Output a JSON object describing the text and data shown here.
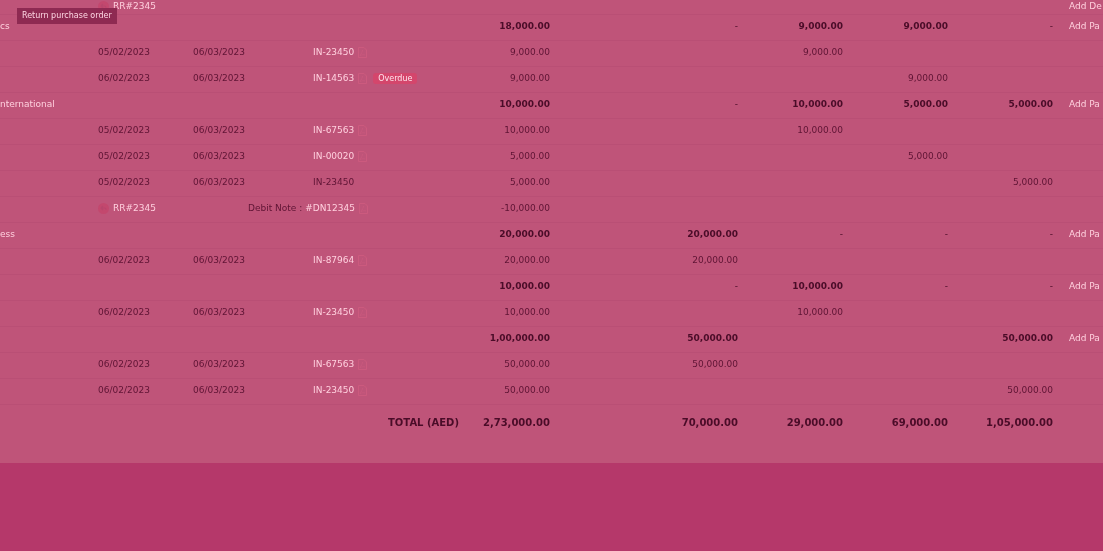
{
  "tooltip": "Return purchase order",
  "rows": [
    {
      "kind": "return",
      "reference": "RR#2345",
      "action": "Add De"
    },
    {
      "kind": "group",
      "name": "cs",
      "amount": "18,000.00",
      "buckets": {
        "bucket_1": "-",
        "bucket_2": "9,000.00",
        "bucket_3": "9,000.00",
        "bucket_4": "-"
      },
      "action": "Add Pa"
    },
    {
      "kind": "invoice",
      "invoice_date": "05/02/2023",
      "due_date": "06/03/2023",
      "invoice": "IN-23450",
      "linked": true,
      "pdf": true,
      "amount": "9,000.00",
      "buckets": {
        "bucket_2": "9,000.00"
      }
    },
    {
      "kind": "invoice",
      "invoice_date": "06/02/2023",
      "due_date": "06/03/2023",
      "invoice": "IN-14563",
      "linked": true,
      "pdf": true,
      "badge": "Overdue",
      "amount": "9,000.00",
      "buckets": {
        "bucket_3": "9,000.00"
      }
    },
    {
      "kind": "group",
      "name": "nternational",
      "amount": "10,000.00",
      "buckets": {
        "bucket_1": "-",
        "bucket_2": "10,000.00",
        "bucket_3": "5,000.00",
        "bucket_4": "5,000.00"
      },
      "action": "Add Pa"
    },
    {
      "kind": "invoice",
      "invoice_date": "05/02/2023",
      "due_date": "06/03/2023",
      "invoice": "IN-67563",
      "linked": true,
      "pdf": true,
      "amount": "10,000.00",
      "buckets": {
        "bucket_2": "10,000.00"
      }
    },
    {
      "kind": "invoice",
      "invoice_date": "05/02/2023",
      "due_date": "06/03/2023",
      "invoice": "IN-00020",
      "linked": true,
      "pdf": true,
      "amount": "5,000.00",
      "buckets": {
        "bucket_3": "5,000.00"
      }
    },
    {
      "kind": "invoice",
      "invoice_date": "05/02/2023",
      "due_date": "06/03/2023",
      "invoice": "IN-23450",
      "linked": false,
      "pdf": false,
      "amount": "5,000.00",
      "buckets": {
        "bucket_4": "5,000.00"
      }
    },
    {
      "kind": "debit",
      "reference": "RR#2345",
      "note_label": "Debit Note :",
      "note_number": "#DN12345",
      "amount": "-10,000.00"
    },
    {
      "kind": "group",
      "name": "ess",
      "amount": "20,000.00",
      "buckets": {
        "bucket_1": "20,000.00",
        "bucket_2": "-",
        "bucket_3": "-",
        "bucket_4": "-"
      },
      "action": "Add Pa"
    },
    {
      "kind": "invoice",
      "invoice_date": "06/02/2023",
      "due_date": "06/03/2023",
      "invoice": "IN-87964",
      "linked": true,
      "pdf": true,
      "amount": "20,000.00",
      "buckets": {
        "bucket_1": "20,000.00"
      }
    },
    {
      "kind": "group",
      "amount": "10,000.00",
      "buckets": {
        "bucket_1": "-",
        "bucket_2": "10,000.00",
        "bucket_3": "-",
        "bucket_4": "-"
      },
      "action": "Add Pa"
    },
    {
      "kind": "invoice",
      "invoice_date": "06/02/2023",
      "due_date": "06/03/2023",
      "invoice": "IN-23450",
      "linked": true,
      "pdf": true,
      "amount": "10,000.00",
      "buckets": {
        "bucket_2": "10,000.00"
      }
    },
    {
      "kind": "group",
      "amount": "1,00,000.00",
      "buckets": {
        "bucket_1": "50,000.00",
        "bucket_4": "50,000.00"
      },
      "action": "Add Pa"
    },
    {
      "kind": "invoice",
      "invoice_date": "06/02/2023",
      "due_date": "06/03/2023",
      "invoice": "IN-67563",
      "linked": true,
      "pdf": true,
      "amount": "50,000.00",
      "buckets": {
        "bucket_1": "50,000.00"
      }
    },
    {
      "kind": "invoice",
      "invoice_date": "06/02/2023",
      "due_date": "06/03/2023",
      "invoice": "IN-23450",
      "linked": true,
      "pdf": true,
      "amount": "50,000.00",
      "buckets": {
        "bucket_4": "50,000.00"
      }
    }
  ],
  "total": {
    "label": "TOTAL (AED)",
    "amount": "2,73,000.00",
    "buckets": {
      "bucket_1": "70,000.00",
      "bucket_2": "29,000.00",
      "bucket_3": "69,000.00",
      "bucket_4": "1,05,000.00"
    }
  }
}
